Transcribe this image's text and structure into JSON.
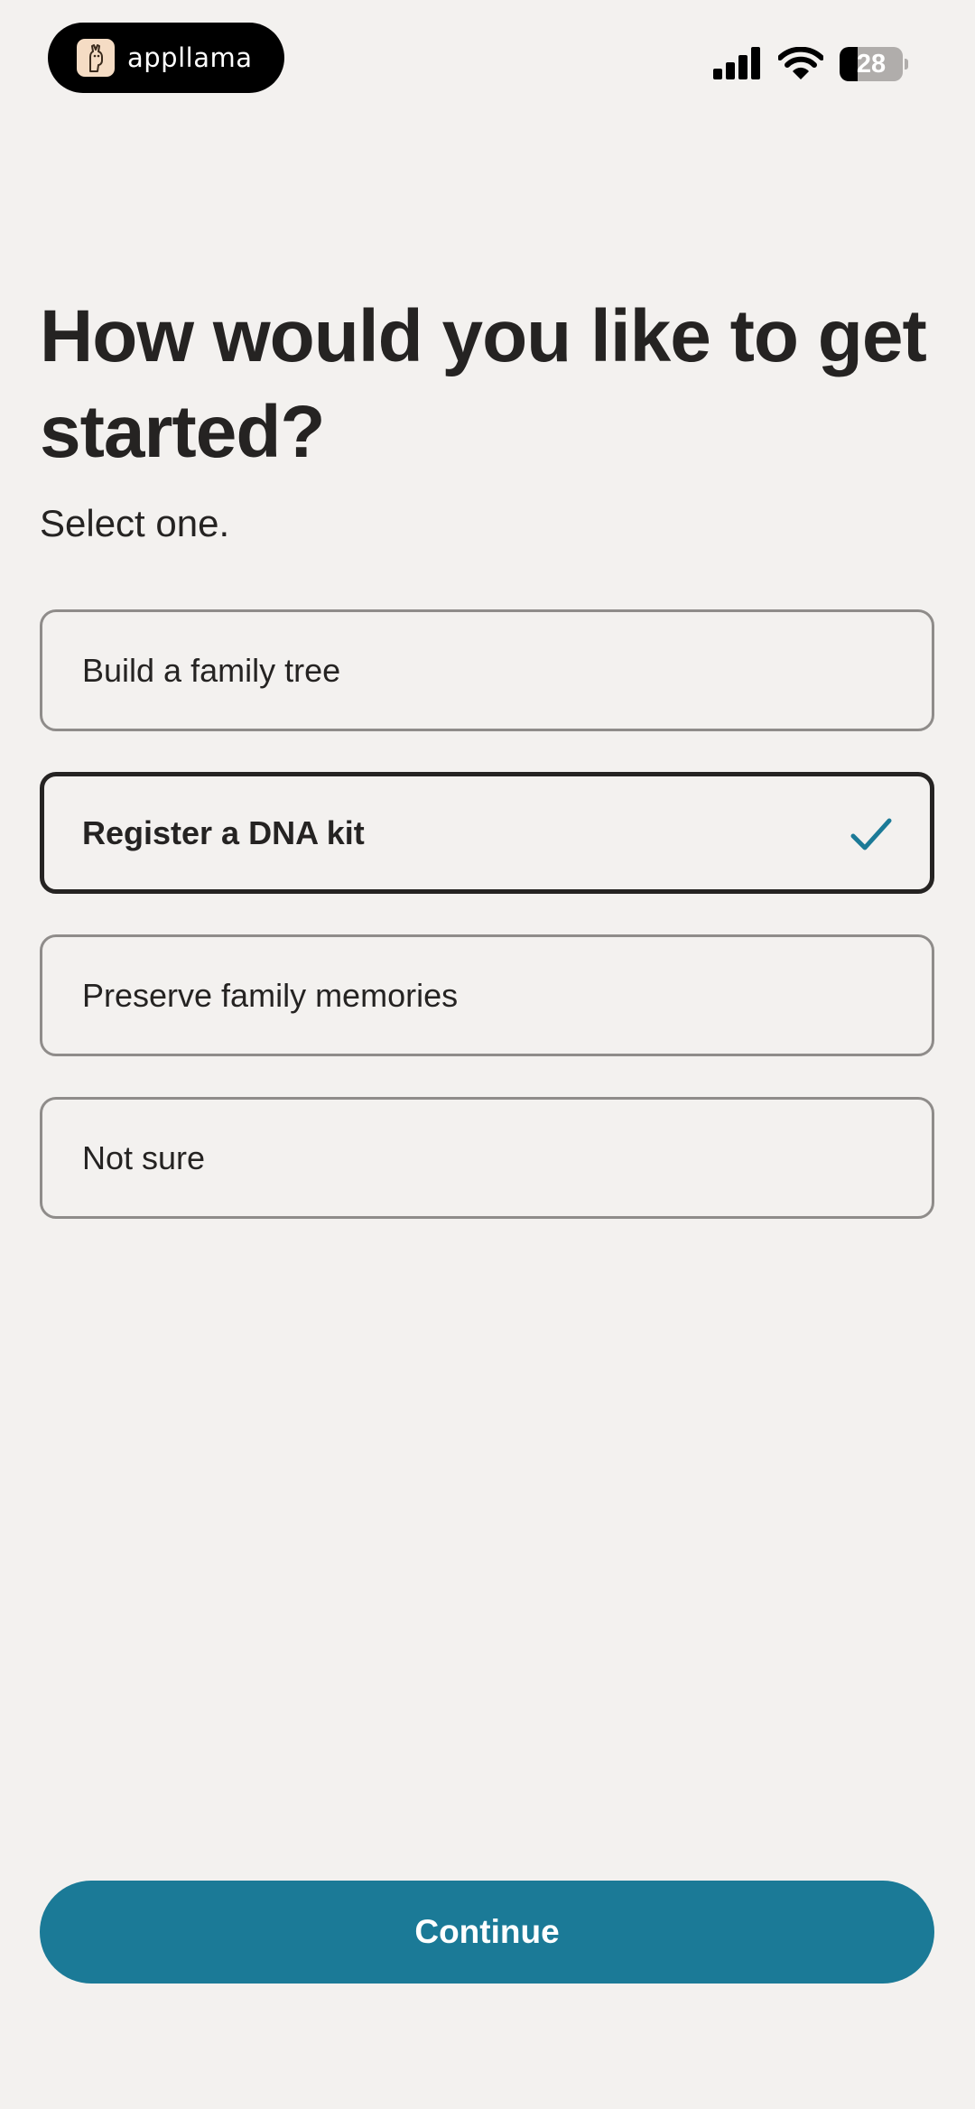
{
  "status_bar": {
    "brand_name": "appllama",
    "brand_icon": "llama-icon",
    "signal_icon": "cellular-signal-icon",
    "wifi_icon": "wifi-icon",
    "battery_level": "28",
    "battery_fraction": 0.28
  },
  "header": {
    "title": "How would you like to get started?",
    "subtitle": "Select one."
  },
  "options": [
    {
      "label": "Build a family tree",
      "selected": false
    },
    {
      "label": "Register a DNA kit",
      "selected": true
    },
    {
      "label": "Preserve family memories",
      "selected": false
    },
    {
      "label": "Not sure",
      "selected": false
    }
  ],
  "continue_label": "Continue",
  "colors": {
    "background": "#f3f1ef",
    "text": "#252322",
    "accent": "#1b7a97",
    "option_border": "#8f8c8a",
    "selected_border": "#252322"
  }
}
